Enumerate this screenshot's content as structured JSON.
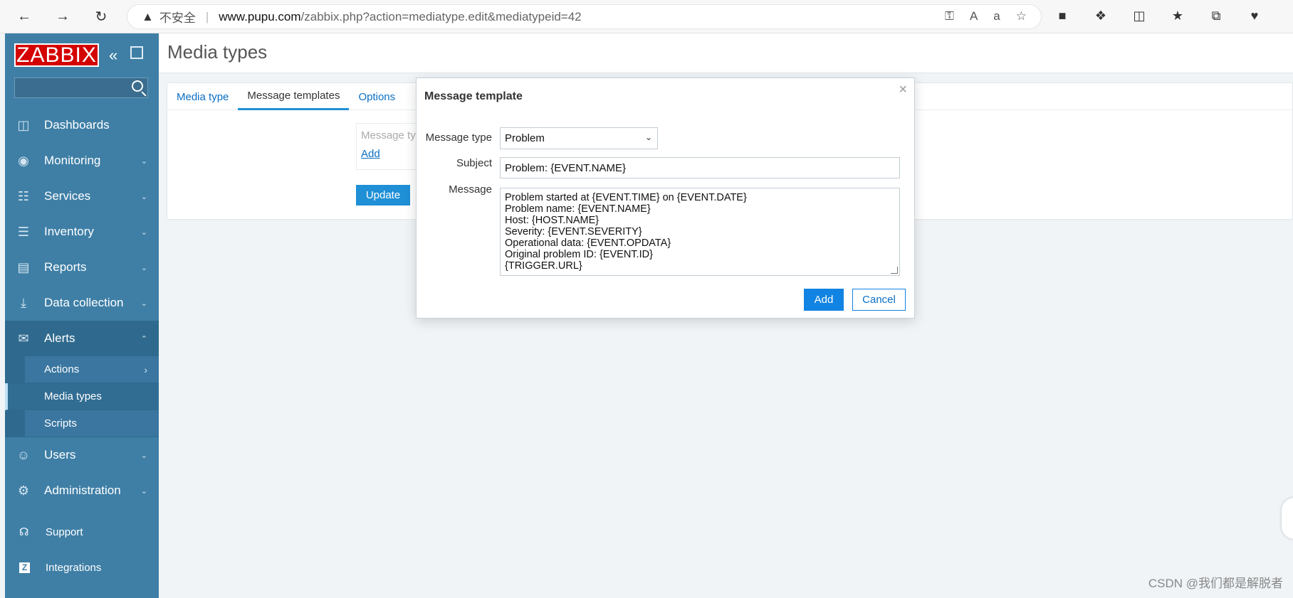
{
  "browser": {
    "insecure_label": "不安全",
    "url_host": "www.pupu.com",
    "url_path": "/zabbix.php?action=mediatype.edit&mediatypeid=42"
  },
  "sidebar": {
    "logo": "ZABBIX",
    "menu": [
      {
        "label": "Dashboards",
        "icon": "dashboard-icon"
      },
      {
        "label": "Monitoring",
        "icon": "eye-icon"
      },
      {
        "label": "Services",
        "icon": "services-icon"
      },
      {
        "label": "Inventory",
        "icon": "list-icon"
      },
      {
        "label": "Reports",
        "icon": "report-icon"
      },
      {
        "label": "Data collection",
        "icon": "download-icon"
      },
      {
        "label": "Alerts",
        "icon": "mail-icon"
      }
    ],
    "alerts_submenu": [
      "Actions",
      "Media types",
      "Scripts"
    ],
    "menu_after": [
      {
        "label": "Users",
        "icon": "users-icon"
      },
      {
        "label": "Administration",
        "icon": "gear-icon"
      }
    ],
    "footer": [
      {
        "label": "Support",
        "icon": "headset-icon"
      },
      {
        "label": "Integrations",
        "icon": "zabbix-z-icon"
      }
    ]
  },
  "main": {
    "title": "Media types",
    "tabs": [
      "Media type",
      "Message templates",
      "Options"
    ],
    "inner_box_label": "Message ty",
    "inner_box_add": "Add",
    "update_button": "Update"
  },
  "modal": {
    "title": "Message template",
    "message_type_label": "Message type",
    "message_type_value": "Problem",
    "subject_label": "Subject",
    "subject_value": "Problem: {EVENT.NAME}",
    "message_label": "Message",
    "message_lines": [
      "Problem started at {EVENT.TIME} on {EVENT.DATE}",
      "Problem name: {EVENT.NAME}",
      "Host: {HOST.NAME}",
      "Severity: {EVENT.SEVERITY}",
      "Operational data: {EVENT.OPDATA}",
      "Original problem ID: {EVENT.ID}",
      "{TRIGGER.URL}"
    ],
    "add_button": "Add",
    "cancel_button": "Cancel"
  },
  "watermark": "CSDN @我们都是解脱者"
}
